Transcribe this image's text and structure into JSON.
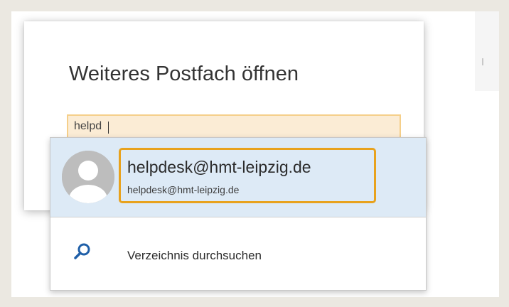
{
  "dialog": {
    "title": "Weiteres Postfach öffnen",
    "search": {
      "value": "helpd"
    }
  },
  "suggestions": [
    {
      "display_name": "helpdesk@hmt-leipzig.de",
      "email": "helpdesk@hmt-leipzig.de",
      "avatar_icon": "default-person-avatar-icon"
    }
  ],
  "directory_search": {
    "label": "Verzeichnis durchsuchen",
    "icon": "search-icon"
  },
  "colors": {
    "page_background": "#ebe8e1",
    "input_background": "#fbecd5",
    "input_border": "#f5cf8a",
    "suggestion_background": "#ddeaf6",
    "highlight_border": "#e8a21d",
    "search_icon": "#1f5fa8"
  }
}
